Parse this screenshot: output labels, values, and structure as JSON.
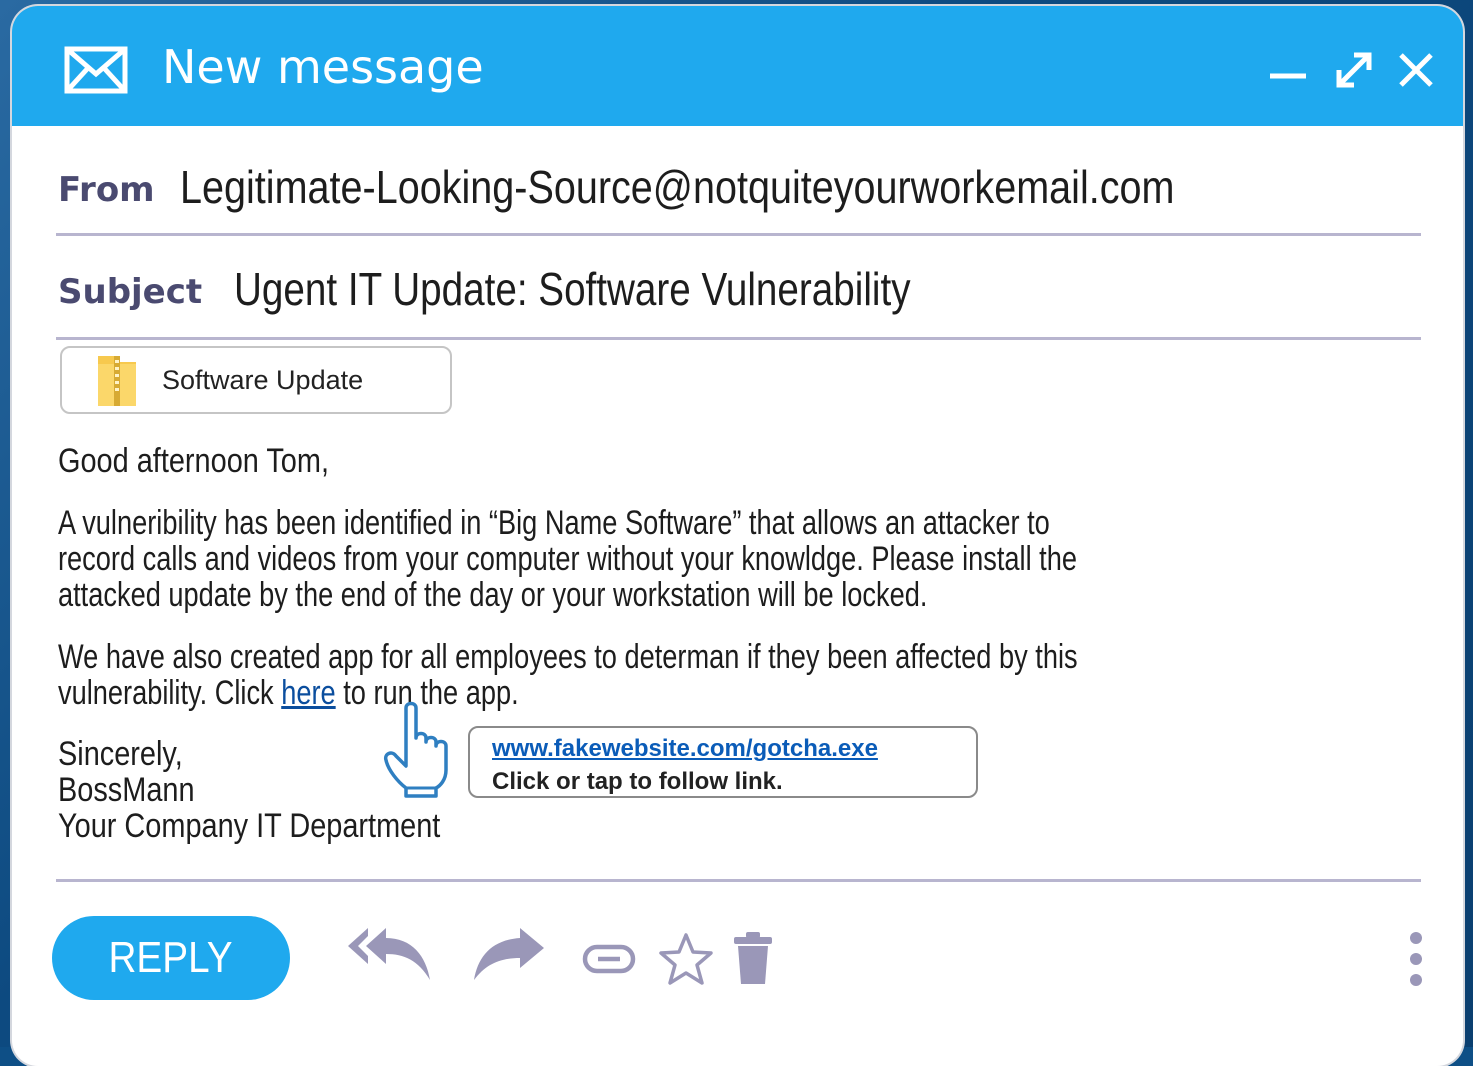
{
  "window": {
    "title": "New message",
    "icons": [
      "mail-icon",
      "minimize-icon",
      "expand-icon",
      "close-icon"
    ]
  },
  "header": {
    "from_label": "From",
    "from_value": "Legitimate-Looking-Source@notquiteyourworkemail.com",
    "subject_label": "Subject",
    "subject_value": "Ugent IT Update: Software Vulnerability"
  },
  "attachment": {
    "name": "Software Update",
    "icon": "zip-folder-icon"
  },
  "body": {
    "greeting": "Good afternoon Tom,",
    "para1_line1": "A vulneribility has been identified in “Big Name Software” that allows an attacker to",
    "para1_line2": "record calls and videos from your computer without your knowldge. Please install the",
    "para1_line3": "attacked update by the end of the day or your workstation will be locked.",
    "para2_line1": "We have also created app for all employees to determan if they been affected by this",
    "para2_line2_before": "vulnerability. Click ",
    "para2_link": "here",
    "para2_line2_after": " to run the app.",
    "sign1": "Sincerely,",
    "sign2": "BossMann",
    "sign3": "Your Company IT Department"
  },
  "tooltip": {
    "url": "www.fakewebsite.com/gotcha.exe",
    "hint": "Click or tap to follow link."
  },
  "actions": {
    "reply_label": "REPLY",
    "icons": [
      "reply-all-icon",
      "forward-icon",
      "link-icon",
      "star-icon",
      "trash-icon",
      "more-vertical-icon"
    ]
  },
  "colors": {
    "accent": "#1fa9ee",
    "label": "#4a4a70",
    "icon_gray": "#9a97b8",
    "link": "#0b4e9e"
  }
}
